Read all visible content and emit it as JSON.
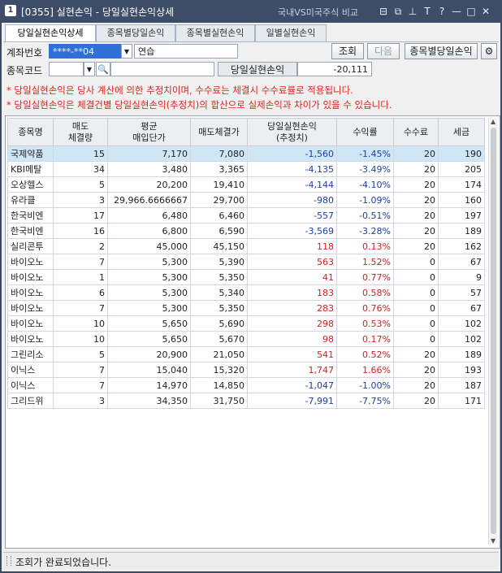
{
  "window": {
    "number": "1",
    "title": "[0355] 실현손익 - 당일실현손익상세",
    "compare_link": "국내VS미국주식 비교",
    "icons": [
      "restore-icon",
      "copy-window-icon",
      "pin-icon",
      "font-size-icon",
      "help-icon",
      "minimize-icon",
      "maximize-icon",
      "close-icon"
    ],
    "icon_glyphs": [
      "⊟",
      "⧉",
      "⊥",
      "T",
      "?",
      "—",
      "□",
      "✕"
    ]
  },
  "tabs": [
    {
      "label": "당일실현손익상세",
      "active": true
    },
    {
      "label": "종목별당일손익",
      "active": false
    },
    {
      "label": "종목별실현손익",
      "active": false
    },
    {
      "label": "일별실현손익",
      "active": false
    }
  ],
  "form": {
    "account_label": "계좌번호",
    "account_value": "****-**04",
    "account_name": "연습",
    "stock_code_label": "종목코드",
    "stock_code_value": "",
    "stock_name_value": "",
    "pnl_label": "당일실현손익",
    "pnl_value": "-20,111",
    "btn_query": "조회",
    "btn_next": "다음",
    "btn_by_stock": "종목별당일손익"
  },
  "notices": [
    "* 당일실현손익은 당사 계산에 의한 추정치이며, 수수료는 체결시 수수료률로 적용됩니다.",
    "* 당일실현손익은 체결건별 당일실현손익(추정치)의 합산으로 실제손익과 차이가 있을 수 있습니다."
  ],
  "table": {
    "headers": [
      [
        "종목명"
      ],
      [
        "매도",
        "체결량"
      ],
      [
        "평균",
        "매입단가"
      ],
      [
        "매도체결가"
      ],
      [
        "당일실현손익",
        "(추정치)"
      ],
      [
        "수익률"
      ],
      [
        "수수료"
      ],
      [
        "세금"
      ]
    ],
    "rows": [
      [
        "국제약품",
        "15",
        "7,170",
        "7,080",
        "-1,560",
        "-1.45%",
        "20",
        "190"
      ],
      [
        "KBI메탈",
        "34",
        "3,480",
        "3,365",
        "-4,135",
        "-3.49%",
        "20",
        "205"
      ],
      [
        "오상헬스",
        "5",
        "20,200",
        "19,410",
        "-4,144",
        "-4.10%",
        "20",
        "174"
      ],
      [
        "유라클",
        "3",
        "29,966.6666667",
        "29,700",
        "-980",
        "-1.09%",
        "20",
        "160"
      ],
      [
        "한국비엔",
        "17",
        "6,480",
        "6,460",
        "-557",
        "-0.51%",
        "20",
        "197"
      ],
      [
        "한국비엔",
        "16",
        "6,800",
        "6,590",
        "-3,569",
        "-3.28%",
        "20",
        "189"
      ],
      [
        "실리콘투",
        "2",
        "45,000",
        "45,150",
        "118",
        "0.13%",
        "20",
        "162"
      ],
      [
        "바이오노",
        "7",
        "5,300",
        "5,390",
        "563",
        "1.52%",
        "0",
        "67"
      ],
      [
        "바이오노",
        "1",
        "5,300",
        "5,350",
        "41",
        "0.77%",
        "0",
        "9"
      ],
      [
        "바이오노",
        "6",
        "5,300",
        "5,340",
        "183",
        "0.58%",
        "0",
        "57"
      ],
      [
        "바이오노",
        "7",
        "5,300",
        "5,350",
        "283",
        "0.76%",
        "0",
        "67"
      ],
      [
        "바이오노",
        "10",
        "5,650",
        "5,690",
        "298",
        "0.53%",
        "0",
        "102"
      ],
      [
        "바이오노",
        "10",
        "5,650",
        "5,670",
        "98",
        "0.17%",
        "0",
        "102"
      ],
      [
        "그린리소",
        "5",
        "20,900",
        "21,050",
        "541",
        "0.52%",
        "20",
        "189"
      ],
      [
        "이닉스",
        "7",
        "15,040",
        "15,320",
        "1,747",
        "1.66%",
        "20",
        "193"
      ],
      [
        "이닉스",
        "7",
        "14,970",
        "14,850",
        "-1,047",
        "-1.00%",
        "20",
        "187"
      ],
      [
        "그리드위",
        "3",
        "34,350",
        "31,750",
        "-7,991",
        "-7.75%",
        "20",
        "171"
      ]
    ],
    "selected_row": 0
  },
  "status": {
    "message": "조회가 완료되었습니다."
  }
}
